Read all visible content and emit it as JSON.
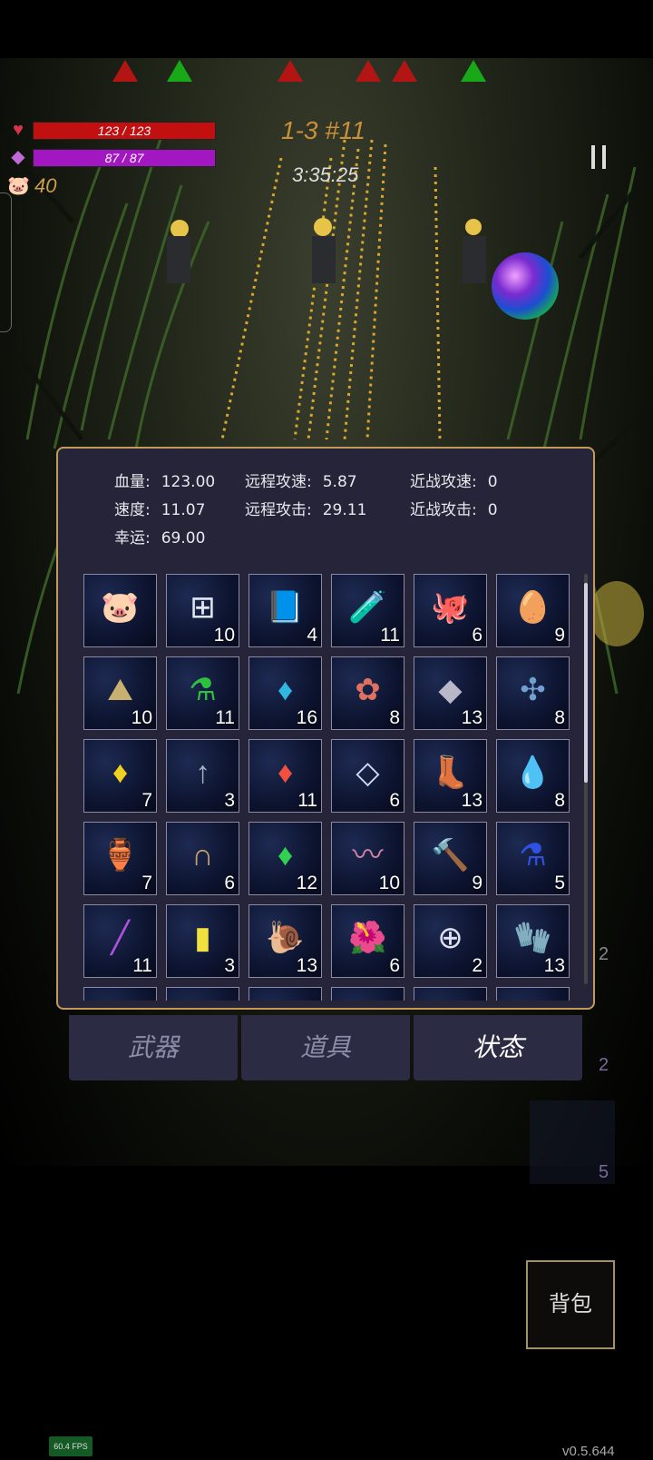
{
  "hud": {
    "hp_text": "123 / 123",
    "mp_text": "87 / 87",
    "coins": "40",
    "stage": "1-3 #11",
    "timer": "3:35:25",
    "markers": [
      "red",
      "green",
      "red",
      "red",
      "red",
      "green"
    ]
  },
  "stats": [
    {
      "label": "血量:",
      "value": "123.00"
    },
    {
      "label": "远程攻速:",
      "value": "5.87"
    },
    {
      "label": "近战攻速:",
      "value": "0"
    },
    {
      "label": "速度:",
      "value": "11.07"
    },
    {
      "label": "远程攻击:",
      "value": "29.11"
    },
    {
      "label": "近战攻击:",
      "value": "0"
    },
    {
      "label": "幸运:",
      "value": "69.00"
    }
  ],
  "items": [
    {
      "icon": "piggy-bank-icon",
      "glyph": "🐷",
      "count": ""
    },
    {
      "icon": "medkit-icon",
      "glyph": "⊞",
      "count": "10"
    },
    {
      "icon": "spellbook-icon",
      "glyph": "📘",
      "count": "4"
    },
    {
      "icon": "vial-icon",
      "glyph": "🧪",
      "count": "11"
    },
    {
      "icon": "octopus-icon",
      "glyph": "🐙",
      "count": "6"
    },
    {
      "icon": "egg-icon",
      "glyph": "🥚",
      "count": "9"
    },
    {
      "icon": "ore-icon",
      "glyph": "⛰",
      "count": "10"
    },
    {
      "icon": "green-potion-icon",
      "glyph": "⚗",
      "count": "11"
    },
    {
      "icon": "blue-crystal-icon",
      "glyph": "♦",
      "count": "16"
    },
    {
      "icon": "flowers-icon",
      "glyph": "✿",
      "count": "8"
    },
    {
      "icon": "stone-icon",
      "glyph": "◆",
      "count": "13"
    },
    {
      "icon": "dragonfly-icon",
      "glyph": "✣",
      "count": "8"
    },
    {
      "icon": "yellow-crystal-icon",
      "glyph": "♦",
      "count": "7"
    },
    {
      "icon": "arrow-icon",
      "glyph": "↑",
      "count": "3"
    },
    {
      "icon": "red-crystal-icon",
      "glyph": "♦",
      "count": "11"
    },
    {
      "icon": "diamond-plate-icon",
      "glyph": "◇",
      "count": "6"
    },
    {
      "icon": "boots-icon",
      "glyph": "👢",
      "count": "13"
    },
    {
      "icon": "water-drop-icon",
      "glyph": "💧",
      "count": "8"
    },
    {
      "icon": "heart-jar-icon",
      "glyph": "🏺",
      "count": "7"
    },
    {
      "icon": "horseshoe-icon",
      "glyph": "∩",
      "count": "6"
    },
    {
      "icon": "green-gem-icon",
      "glyph": "♦",
      "count": "12"
    },
    {
      "icon": "worm-icon",
      "glyph": "〰",
      "count": "10"
    },
    {
      "icon": "hammer-icon",
      "glyph": "🔨",
      "count": "9"
    },
    {
      "icon": "blue-potion-icon",
      "glyph": "⚗",
      "count": "5"
    },
    {
      "icon": "purple-wand-icon",
      "glyph": "╱",
      "count": "11"
    },
    {
      "icon": "yellow-card-icon",
      "glyph": "▮",
      "count": "3"
    },
    {
      "icon": "purple-snail-icon",
      "glyph": "🐌",
      "count": "13"
    },
    {
      "icon": "red-flower-icon",
      "glyph": "🌺",
      "count": "6"
    },
    {
      "icon": "ring-icon",
      "glyph": "⊕",
      "count": "2"
    },
    {
      "icon": "gloves-icon",
      "glyph": "🧤",
      "count": "13"
    },
    {
      "icon": "empty-icon",
      "glyph": "",
      "count": ""
    },
    {
      "icon": "empty-icon",
      "glyph": "",
      "count": ""
    },
    {
      "icon": "empty-icon",
      "glyph": "",
      "count": ""
    },
    {
      "icon": "empty-icon",
      "glyph": "",
      "count": ""
    },
    {
      "icon": "empty-icon",
      "glyph": "",
      "count": ""
    },
    {
      "icon": "empty-icon",
      "glyph": "",
      "count": ""
    }
  ],
  "tabs": [
    "武器",
    "道具",
    "状态"
  ],
  "bag_label": "背包",
  "fps": "60.4 FPS",
  "version": "v0.5.644",
  "side_numbers": [
    "2",
    "2",
    "5"
  ]
}
